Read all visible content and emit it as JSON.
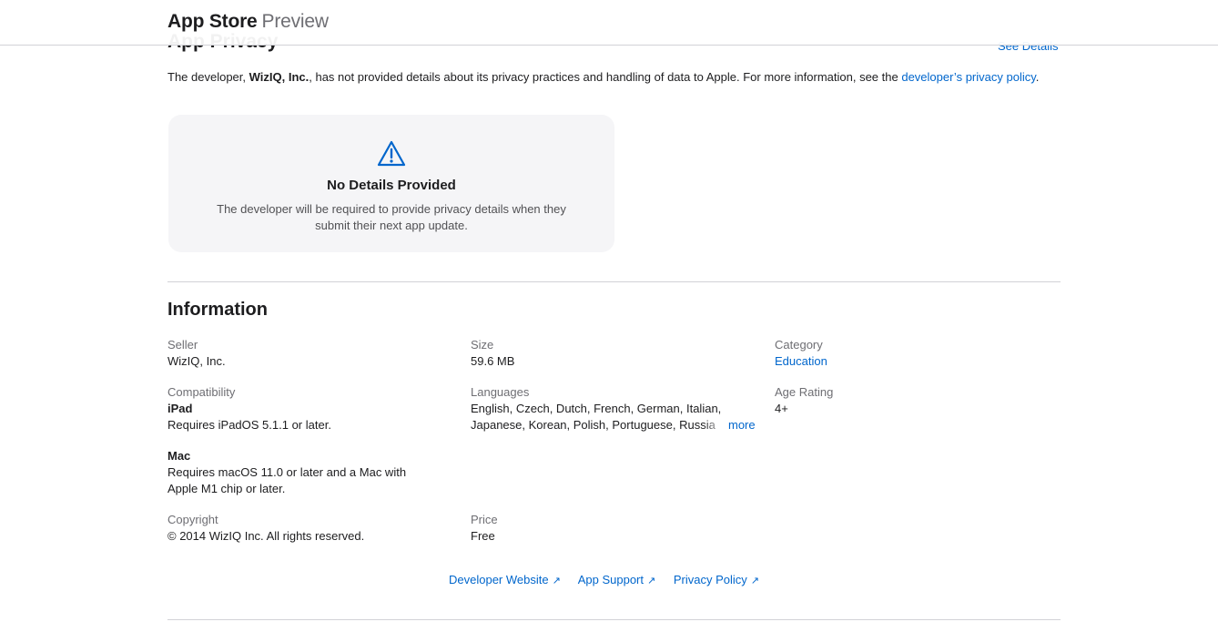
{
  "header": {
    "brand_main": "App Store",
    "brand_sub": "Preview"
  },
  "privacy": {
    "title": "App Privacy",
    "see_details": "See Details",
    "text_prefix": "The developer, ",
    "developer": "WizIQ, Inc.",
    "text_middle": ", has not provided details about its privacy practices and handling of data to Apple. For more information, see the ",
    "policy_link": "developer’s privacy policy",
    "text_suffix": ".",
    "card": {
      "icon": "warning-icon",
      "title": "No Details Provided",
      "description": "The developer will be required to provide privacy details when they submit their next app update."
    }
  },
  "information": {
    "title": "Information",
    "seller": {
      "label": "Seller",
      "value": "WizIQ, Inc."
    },
    "size": {
      "label": "Size",
      "value": "59.6 MB"
    },
    "category": {
      "label": "Category",
      "value": "Education"
    },
    "compatibility": {
      "label": "Compatibility",
      "ipad_title": "iPad",
      "ipad_req": "Requires iPadOS 5.1.1 or later.",
      "mac_title": "Mac",
      "mac_req": "Requires macOS 11.0 or later and a Mac with Apple M1 chip or later."
    },
    "languages": {
      "label": "Languages",
      "line1": "English, Czech, Dutch, French, German, Italian,",
      "line2": "Japanese, Korean, Polish, Portuguese, Russia",
      "more": "more"
    },
    "age_rating": {
      "label": "Age Rating",
      "value": "4+"
    },
    "copyright": {
      "label": "Copyright",
      "value": "© 2014 WizIQ Inc. All rights reserved."
    },
    "price": {
      "label": "Price",
      "value": "Free"
    }
  },
  "links": {
    "developer_website": "Developer Website",
    "app_support": "App Support",
    "privacy_policy": "Privacy Policy",
    "arrow": "↗"
  },
  "colors": {
    "link": "#0066cc",
    "text": "#1d1d1f",
    "muted": "#6e6e73",
    "card_bg": "#f5f5f7"
  }
}
